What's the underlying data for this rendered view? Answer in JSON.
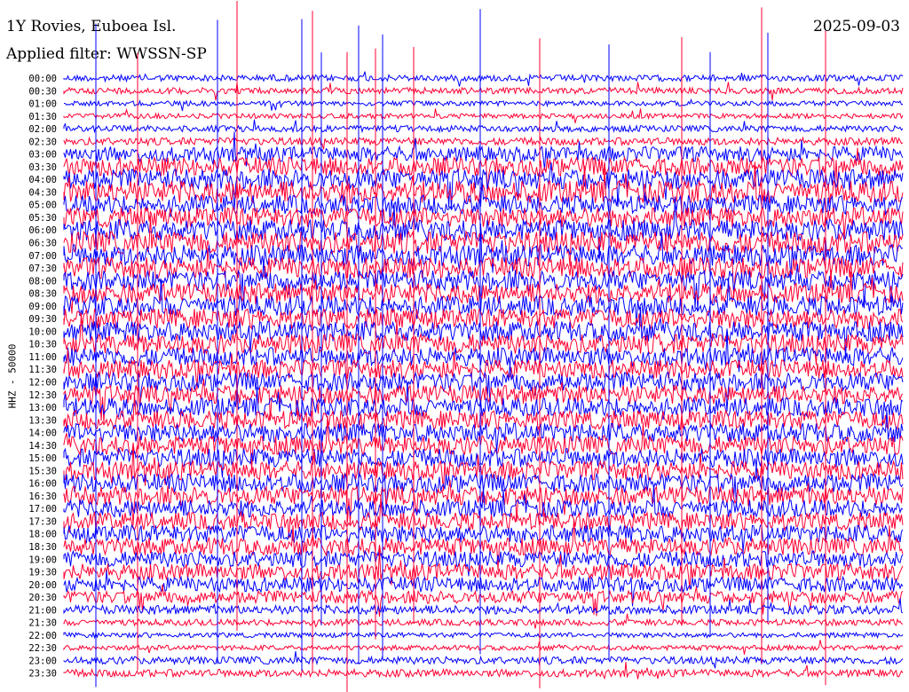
{
  "header": {
    "station": "1Y Rovies, Euboea Isl.",
    "date": "2025-09-03",
    "filter": "Applied filter: WWSSN-SP"
  },
  "colors": {
    "trace_a": "#0000ff",
    "trace_b": "#ff0033",
    "background": "#ffffff"
  },
  "chart_data": {
    "type": "line",
    "title": "1Y Rovies, Euboea Isl.",
    "ylabel": "HHZ - 50000",
    "xlabel": "",
    "row_labels": [
      "00:00",
      "00:30",
      "01:00",
      "01:30",
      "02:00",
      "02:30",
      "03:00",
      "03:30",
      "04:00",
      "04:30",
      "05:00",
      "05:30",
      "06:00",
      "06:30",
      "07:00",
      "07:30",
      "08:00",
      "08:30",
      "09:00",
      "09:30",
      "10:00",
      "10:30",
      "11:00",
      "11:30",
      "12:00",
      "12:30",
      "13:00",
      "13:30",
      "14:00",
      "14:30",
      "15:00",
      "15:30",
      "16:00",
      "16:30",
      "17:00",
      "17:30",
      "18:00",
      "18:30",
      "19:00",
      "19:30",
      "20:00",
      "20:30",
      "21:00",
      "21:30",
      "22:00",
      "22:30",
      "23:00",
      "23:30"
    ],
    "row_amplitude": [
      0.5,
      0.5,
      0.4,
      0.4,
      0.5,
      0.6,
      1.2,
      1.5,
      1.6,
      1.8,
      1.5,
      1.6,
      1.7,
      1.8,
      1.7,
      1.7,
      1.6,
      1.6,
      1.6,
      1.6,
      1.6,
      1.6,
      1.5,
      1.5,
      1.5,
      1.5,
      1.5,
      1.5,
      1.5,
      1.5,
      1.5,
      1.5,
      1.5,
      1.5,
      1.4,
      1.4,
      1.4,
      1.4,
      1.3,
      1.3,
      1.2,
      1.0,
      0.7,
      0.5,
      0.4,
      0.4,
      0.6,
      0.6
    ],
    "row_colors": [
      "blue",
      "red"
    ],
    "grid": false
  }
}
